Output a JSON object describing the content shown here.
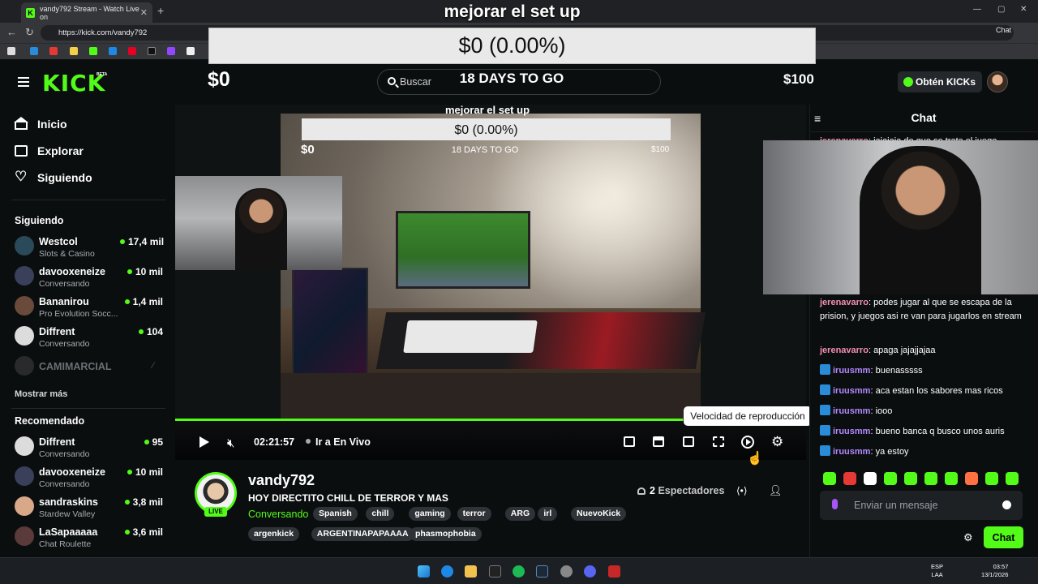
{
  "browser": {
    "tab_title": "vandy792 Stream - Watch Live on",
    "tab_close": "✕",
    "new_tab": "+",
    "url": "https://kick.com/vandy792",
    "chat_button": "Chat"
  },
  "goal_overlay": {
    "title": "mejorar el set up",
    "amount": "$0 (0.00%)",
    "start": "$0",
    "days_left": "18 DAYS TO GO",
    "target": "$100"
  },
  "header": {
    "logo": "KICK",
    "logo_badge": "BETA",
    "search_placeholder": "Buscar",
    "get_kicks": "Obtén KICKs"
  },
  "sidebar": {
    "nav": [
      {
        "label": "Inicio",
        "icon": "home-icon"
      },
      {
        "label": "Explorar",
        "icon": "explore-icon"
      },
      {
        "label": "Siguiendo",
        "icon": "heart-icon"
      }
    ],
    "following_title": "Siguiendo",
    "following": [
      {
        "name": "Westcol",
        "sub": "Slots & Casino",
        "count": "17,4 mil",
        "color": "#2a4a5a"
      },
      {
        "name": "davooxeneize",
        "sub": "Conversando",
        "count": "10 mil",
        "color": "#3a3f5a"
      },
      {
        "name": "Bananirou",
        "sub": "Pro Evolution Socc...",
        "count": "1,4 mil",
        "color": "#6a4a3a"
      },
      {
        "name": "Diffrent",
        "sub": "Conversando",
        "count": "104",
        "color": "#dcdcdc"
      },
      {
        "name": "CAMIMARCIAL",
        "sub": "",
        "count": "",
        "color": "#555"
      }
    ],
    "show_more": "Mostrar más",
    "recommended_title": "Recomendado",
    "recommended": [
      {
        "name": "Diffrent",
        "sub": "Conversando",
        "count": "95",
        "color": "#dcdcdc"
      },
      {
        "name": "davooxeneize",
        "sub": "Conversando",
        "count": "10 mil",
        "color": "#3a3f5a"
      },
      {
        "name": "sandraskins",
        "sub": "Stardew Valley",
        "count": "3,8 mil",
        "color": "#d8a888"
      },
      {
        "name": "LaSapaaaaa",
        "sub": "Chat Roulette",
        "count": "3,6 mil",
        "color": "#5a3a3a"
      }
    ]
  },
  "player": {
    "nested_overlay": {
      "title": "mejorar el set up",
      "amount": "$0 (0.00%)",
      "start": "$0",
      "days_left": "18 DAYS TO GO",
      "target": "$100"
    },
    "progress_fraction": 0.805,
    "timecode": "02:21:57",
    "go_live": "Ir a En Vivo",
    "tooltip": "Velocidad de reproducción"
  },
  "stream": {
    "streamer": "vandy792",
    "live_badge": "LIVE",
    "title": "HOY DIRECTITO CHILL DE TERROR Y MAS",
    "category": "Conversando",
    "tags_row1": [
      "Spanish",
      "chill",
      "gaming",
      "terror",
      "ARG",
      "irl",
      "NuevoKick"
    ],
    "tags_row2": [
      "argenkick",
      "ARGENTINAPAPAAAA",
      "phasmophobia"
    ],
    "viewers_count": "2",
    "viewers_label": "Espectadores"
  },
  "chat": {
    "title": "Chat",
    "messages": [
      {
        "user": "jerenavarro",
        "text": "podes jugar al que se escapa de la prision, y juegos asi re van para jugarlos en stream",
        "color": "#f48fb1",
        "badge": false
      },
      {
        "user": "jerenavarro",
        "text": "apaga jajajjajaa",
        "color": "#f48fb1",
        "badge": false
      },
      {
        "user": "iruusmm",
        "text": "buenasssss",
        "color": "#b388ff",
        "badge": true
      },
      {
        "user": "iruusmm",
        "text": "aca estan los sabores mas ricos",
        "color": "#b388ff",
        "badge": true
      },
      {
        "user": "iruusmm",
        "text": "iooo",
        "color": "#b388ff",
        "badge": true
      },
      {
        "user": "iruusmm",
        "text": "bueno banca q busco unos auris",
        "color": "#b388ff",
        "badge": true
      },
      {
        "user": "iruusmm",
        "text": "ya estoy",
        "color": "#b388ff",
        "badge": true
      }
    ],
    "partial_message": {
      "user": "jerenavarro",
      "text": "jajajaja de que se trata el juego",
      "color": "#f48fb1"
    },
    "input_placeholder": "Enviar un mensaje",
    "send_label": "Chat"
  },
  "taskbar": {
    "lang": [
      "ESP",
      "LAA"
    ],
    "time": "03:57",
    "date": "13/1/2026"
  }
}
